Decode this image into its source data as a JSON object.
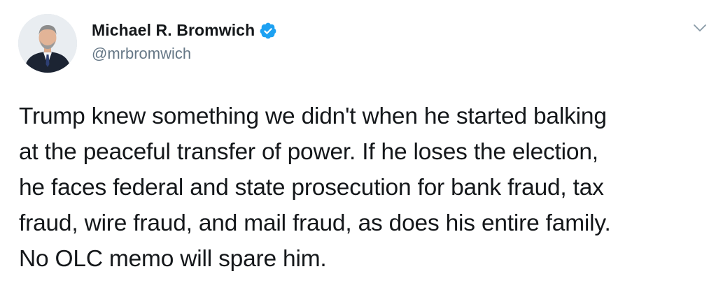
{
  "author": {
    "display_name": "Michael R. Bromwich",
    "handle": "@mrbromwich",
    "verified": true,
    "avatar_icon": "profile-photo",
    "verified_icon": "verified-badge-icon"
  },
  "tweet": {
    "text_lines": [
      "Trump knew something we didn't when he started balking",
      "at the peaceful transfer of power. If he loses the election,",
      "he faces federal and state prosecution for bank fraud, tax",
      "fraud, wire fraud, and mail fraud, as does his entire family.",
      "No OLC memo will spare him."
    ]
  },
  "menu": {
    "icon": "chevron-down-icon"
  },
  "colors": {
    "primary_text": "#14171a",
    "secondary_text": "#657786",
    "verified_blue": "#1da1f2",
    "background": "#ffffff"
  }
}
